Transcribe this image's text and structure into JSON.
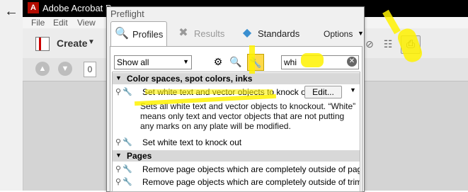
{
  "acrobat": {
    "title": "Adobe Acrobat P",
    "menu": [
      "File",
      "Edit",
      "View"
    ],
    "create_label": "Create",
    "page_number": "0"
  },
  "preflight": {
    "title": "Preflight",
    "tabs": [
      {
        "label": "Profiles",
        "icon": "profiles-icon",
        "active": true
      },
      {
        "label": "Results",
        "icon": "results-icon",
        "active": false
      },
      {
        "label": "Standards",
        "icon": "standards-icon",
        "active": false
      }
    ],
    "options_label": "Options",
    "filter_select": "Show all",
    "search_value": "whi",
    "sections": [
      {
        "title": "Color spaces, spot colors, inks",
        "rows": [
          {
            "label": "Set white text and vector objects to knock out",
            "edit_label": "Edit...",
            "description": [
              "Sets all white text and vector objects to knockout. “White”",
              "means only text and vector objects that are not putting",
              "any marks on any plate will be modified."
            ]
          },
          {
            "label": "Set white text to knock out"
          }
        ]
      },
      {
        "title": "Pages",
        "rows": [
          {
            "label": "Remove page objects which are completely outside of page are"
          },
          {
            "label": "Remove page objects which are completely outside of trim area"
          }
        ]
      }
    ]
  },
  "colors": {
    "highlight": "#fff200",
    "titlebar": "#000000",
    "selected_filter": "#ffd94a"
  }
}
